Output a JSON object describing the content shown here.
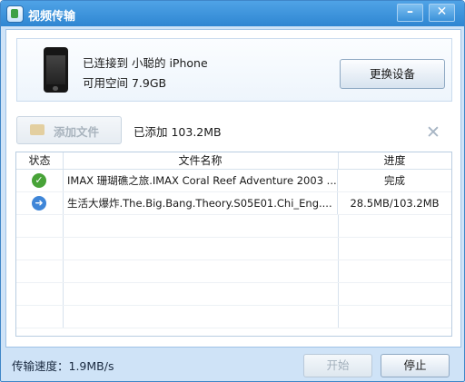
{
  "window": {
    "title": "视频传输",
    "minimize": "–",
    "close": "✕"
  },
  "device": {
    "connection_text": "已连接到 小聪的 iPhone",
    "space_text": "可用空间 7.9GB",
    "change_label": "更换设备"
  },
  "toolbar": {
    "add_label": "添加文件",
    "added_text": "已添加 103.2MB",
    "clear_icon": "✕"
  },
  "table": {
    "headers": [
      "状态",
      "文件名称",
      "进度"
    ],
    "rows": [
      {
        "status": "done",
        "status_icon": "✓",
        "name": "IMAX 珊瑚礁之旅.IMAX Coral Reef Adventure 2003 ...",
        "progress": "完成"
      },
      {
        "status": "transferring",
        "status_icon": "➜",
        "name": "生活大爆炸.The.Big.Bang.Theory.S05E01.Chi_Eng....",
        "progress": "28.5MB/103.2MB"
      }
    ]
  },
  "footer": {
    "speed_text": "传输速度：1.9MB/s",
    "start_label": "开始",
    "stop_label": "停止"
  }
}
